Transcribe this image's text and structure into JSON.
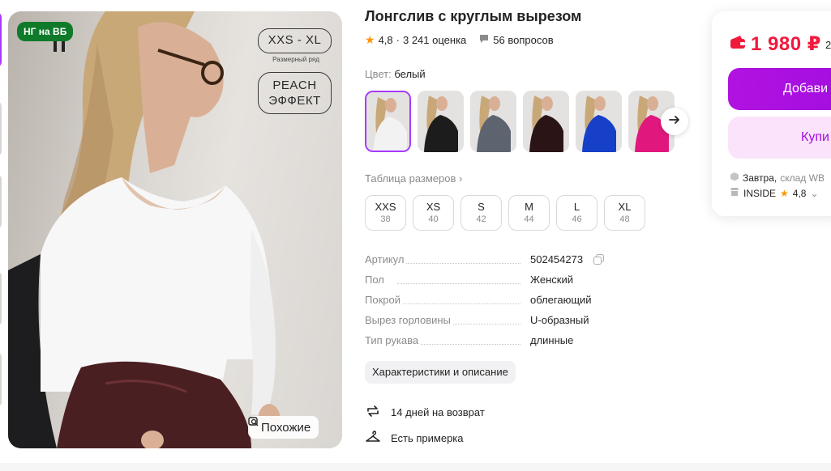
{
  "gallery": {
    "badge": "НГ на ВБ",
    "size_range": "XXS - XL",
    "size_caption": "Размерный ряд",
    "effect_line1": "PEACH",
    "effect_line2": "ЭФФЕКТ",
    "similar_label": "Похожие"
  },
  "product": {
    "title": "Лонгслив с круглым вырезом",
    "rating": "4,8",
    "separator": "·",
    "ratings_count": "3 241 оценка",
    "questions": "56 вопросов",
    "color_key": "Цвет:",
    "color_value": "белый",
    "swatch_colors": [
      "#f2f2f2",
      "#1c1c1c",
      "#5d6470",
      "#2a1416",
      "#1740c8",
      "#e0187e"
    ],
    "size_table_label": "Таблица размеров",
    "sizes": [
      {
        "label": "XXS",
        "num": "38"
      },
      {
        "label": "XS",
        "num": "40"
      },
      {
        "label": "S",
        "num": "42"
      },
      {
        "label": "M",
        "num": "44"
      },
      {
        "label": "L",
        "num": "46"
      },
      {
        "label": "XL",
        "num": "48"
      }
    ],
    "specs": [
      {
        "key": "Артикул",
        "value": "502454273"
      },
      {
        "key": "Пол",
        "value": "Женский"
      },
      {
        "key": "Покрой",
        "value": "облегающий"
      },
      {
        "key": "Вырез горловины",
        "value": "U-образный"
      },
      {
        "key": "Тип рукава",
        "value": "длинные"
      }
    ],
    "chars_button": "Характеристики и описание",
    "return_policy": "14 дней на возврат",
    "fitting": "Есть примерка"
  },
  "buy_card": {
    "price": "1 980 ₽",
    "old_price_partial": "2",
    "add_label": "Добави",
    "buy_label": "Купи",
    "delivery_when": "Завтра,",
    "delivery_where": "склад WB",
    "seller_name": "INSIDE",
    "seller_rating": "4,8"
  },
  "colors": {
    "accent": "#a73afd",
    "price": "#f0193c",
    "badge": "#0f7a2a",
    "star": "#ff9500"
  }
}
